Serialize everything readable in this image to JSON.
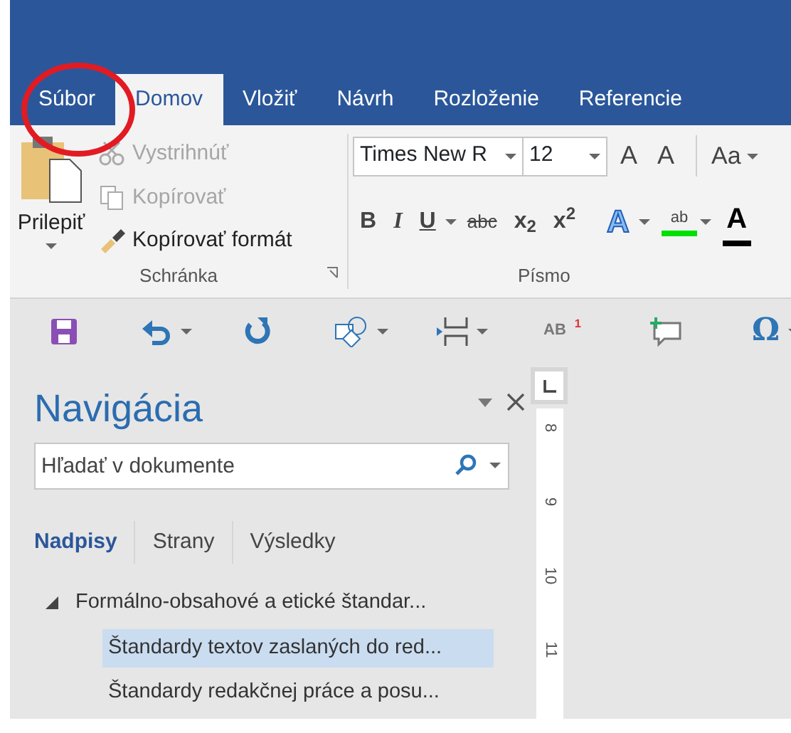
{
  "ribbon_tabs": [
    {
      "label": "Súbor",
      "selected": false
    },
    {
      "label": "Domov",
      "selected": true
    },
    {
      "label": "Vložiť",
      "selected": false
    },
    {
      "label": "Návrh",
      "selected": false
    },
    {
      "label": "Rozloženie",
      "selected": false
    },
    {
      "label": "Referencie",
      "selected": false
    }
  ],
  "annotation": {
    "kind": "circle"
  },
  "clipboard": {
    "paste_label": "Prilepiť",
    "actions": [
      {
        "kind": "cut",
        "label": "Vystrihnúť",
        "disabled": true
      },
      {
        "kind": "copy",
        "label": "Kopírovať",
        "disabled": true
      },
      {
        "kind": "painter",
        "label": "Kopírovať formát",
        "disabled": false
      }
    ],
    "group_label": "Schránka"
  },
  "font": {
    "font_name": "Times New R",
    "font_size": "12",
    "size_buttons": [
      "A",
      "A"
    ],
    "case_button": "Aa",
    "format_buttons": [
      {
        "kind": "bold",
        "label": "B"
      },
      {
        "kind": "italic",
        "label": "I"
      },
      {
        "kind": "underline",
        "label": "U"
      },
      {
        "kind": "strike",
        "label": "abc"
      },
      {
        "kind": "sub",
        "label": "x$_{2}$"
      },
      {
        "kind": "sup",
        "label": "x$^{2}$"
      }
    ],
    "style_buttons": [
      {
        "kind": "effects",
        "label": "A"
      },
      {
        "kind": "highlight",
        "label": "ab"
      },
      {
        "kind": "color",
        "label": "A"
      }
    ],
    "group_label": "Písmo"
  },
  "quick_access": [
    {
      "kind": "save"
    },
    {
      "kind": "undo"
    },
    {
      "kind": "redo"
    },
    {
      "kind": "shapes"
    },
    {
      "kind": "break"
    },
    {
      "kind": "text",
      "label": "AB$^{1}$"
    },
    {
      "kind": "comment"
    },
    {
      "kind": "symbol",
      "label": "Ω"
    }
  ],
  "navigation": {
    "title": "Navigácia",
    "search_placeholder": "Hľadať v dokumente",
    "tabs": [
      {
        "label": "Nadpisy",
        "selected": true
      },
      {
        "label": "Strany",
        "selected": false
      },
      {
        "label": "Výsledky",
        "selected": false
      }
    ],
    "headings": [
      {
        "label": "Formálno-obsahové a etické štandar...",
        "expanded": true,
        "selected": false,
        "children": [
          {
            "label": "Štandardy textov zaslaných do red...",
            "selected": true
          },
          {
            "label": "Štandardy redakčnej práce a posu...",
            "selected": false
          }
        ]
      }
    ]
  },
  "ruler": {
    "marks": [
      "8",
      "9",
      "10",
      "11"
    ]
  }
}
